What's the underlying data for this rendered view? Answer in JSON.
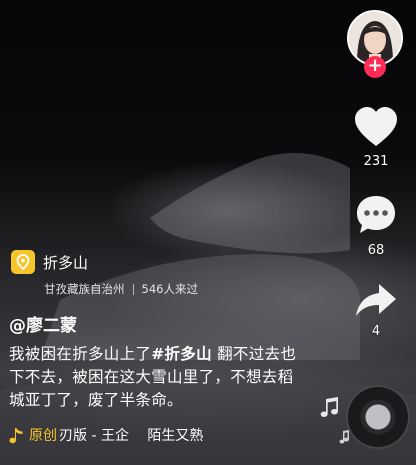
{
  "location": {
    "name": "折多山",
    "region": "甘孜藏族自治州",
    "visitors": "546人来过"
  },
  "post": {
    "author": "@廖二蒙",
    "desc_before": "我被困在折多山上了",
    "hashtag": "#折多山",
    "desc_after": " 翻不过去也下不去，被困在这大雪山里了，不想去稻城亚丁了，废了半条命。"
  },
  "music": {
    "original_label": "原创",
    "track": "刃版 - 王企　 陌生又熟"
  },
  "actions": {
    "likes": "231",
    "comments": "68",
    "shares": "4"
  },
  "icons": [
    "avatar",
    "follow-plus-icon",
    "heart-icon",
    "comment-icon",
    "share-icon",
    "location-pin-icon",
    "music-note-icon",
    "music-disc"
  ],
  "colors": {
    "accent_red": "#fe2c55",
    "accent_yellow": "#f6c52a"
  }
}
